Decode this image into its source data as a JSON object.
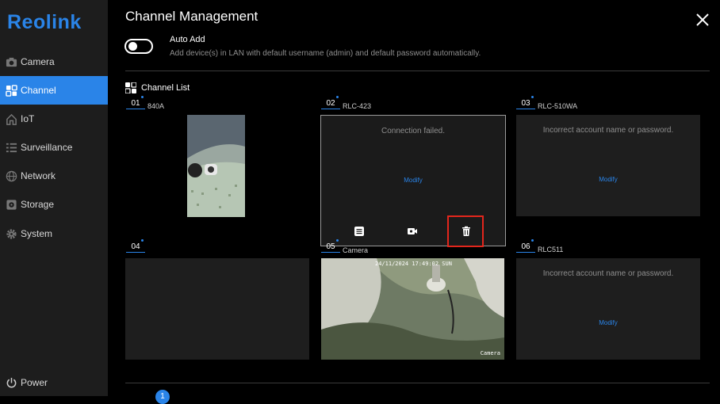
{
  "brand": {
    "logo": "Reolink",
    "accent": "#2a84e8"
  },
  "sidebar": {
    "items": [
      {
        "label": "Camera",
        "icon": "camera-icon",
        "active": false
      },
      {
        "label": "Channel",
        "icon": "grid-icon",
        "active": true
      },
      {
        "label": "IoT",
        "icon": "home-icon",
        "active": false
      },
      {
        "label": "Surveillance",
        "icon": "list-icon",
        "active": false
      },
      {
        "label": "Network",
        "icon": "globe-icon",
        "active": false
      },
      {
        "label": "Storage",
        "icon": "storage-icon",
        "active": false
      },
      {
        "label": "System",
        "icon": "gear-icon",
        "active": false
      }
    ],
    "power_label": "Power"
  },
  "header": {
    "title": "Channel Management"
  },
  "auto_add": {
    "label": "Auto Add",
    "description": "Add device(s) in LAN with default username (admin) and default password automatically.",
    "enabled": false
  },
  "channel_list": {
    "heading": "Channel List",
    "channels": [
      {
        "num": "01",
        "name": "840A",
        "status": "image",
        "message": "",
        "action": ""
      },
      {
        "num": "02",
        "name": "RLC-423",
        "status": "error",
        "message": "Connection failed.",
        "action": "Modify"
      },
      {
        "num": "03",
        "name": "RLC-510WA",
        "status": "error",
        "message": "Incorrect account name or password.",
        "action": "Modify"
      },
      {
        "num": "04",
        "name": "",
        "status": "empty",
        "message": "",
        "action": ""
      },
      {
        "num": "05",
        "name": "Camera",
        "status": "image",
        "message": "",
        "action": "",
        "overlay_timestamp": "24/11/2024 17:49:02 SUN",
        "overlay_name": "Camera"
      },
      {
        "num": "06",
        "name": "RLC511",
        "status": "error",
        "message": "Incorrect account name or password.",
        "action": "Modify"
      }
    ]
  },
  "tile_tools": {
    "icons": [
      "details-icon",
      "video-icon",
      "trash-icon"
    ],
    "highlighted": "trash-icon",
    "highlight_color": "#e3261c"
  },
  "pagination": {
    "current": "1"
  }
}
